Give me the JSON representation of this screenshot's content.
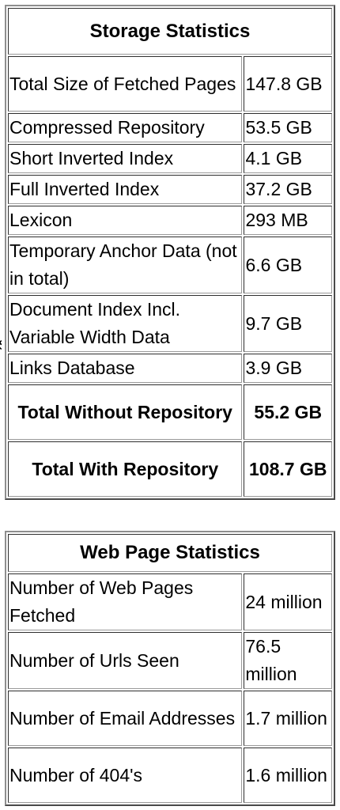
{
  "storage": {
    "title": "Storage Statistics",
    "rows": [
      {
        "label": "Total Size of Fetched Pages",
        "value": "147.8 GB"
      },
      {
        "label": "Compressed Repository",
        "value": "53.5 GB"
      },
      {
        "label": "Short Inverted Index",
        "value": "4.1 GB"
      },
      {
        "label": "Full Inverted Index",
        "value": "37.2 GB"
      },
      {
        "label": "Lexicon",
        "value": "293 MB"
      },
      {
        "label": "Temporary Anchor Data (not in total)",
        "value": "6.6 GB"
      },
      {
        "label": "Document Index Incl. Variable Width Data",
        "value": "9.7 GB"
      },
      {
        "label": "Links Database",
        "value": "3.9 GB"
      },
      {
        "label": "Total Without Repository",
        "value": "55.2 GB"
      },
      {
        "label": "Total With Repository",
        "value": "108.7 GB"
      }
    ]
  },
  "web": {
    "title": "Web Page Statistics",
    "rows": [
      {
        "label": "Number of Web Pages Fetched",
        "value": "24 million"
      },
      {
        "label": "Number of Urls Seen",
        "value": "76.5 million"
      },
      {
        "label": "Number of Email Addresses",
        "value": "1.7 million"
      },
      {
        "label": "Number of 404's",
        "value": "1.6 million"
      }
    ]
  }
}
